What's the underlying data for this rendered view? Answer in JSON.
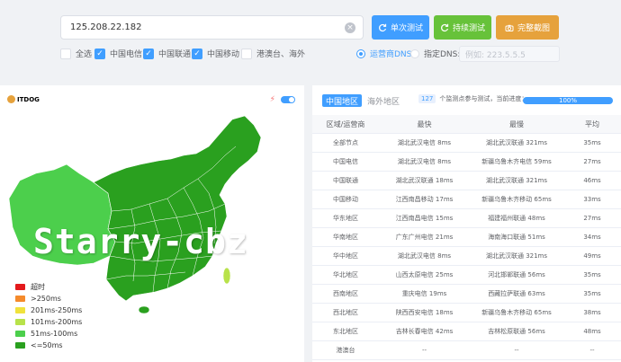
{
  "search": {
    "value": "125.208.22.182"
  },
  "buttons": {
    "single": "单次测试",
    "continuous": "持续测试",
    "screenshot": "完整截图"
  },
  "filters": [
    {
      "label": "全选",
      "checked": false
    },
    {
      "label": "中国电信",
      "checked": true
    },
    {
      "label": "中国联通",
      "checked": true
    },
    {
      "label": "中国移动",
      "checked": true
    },
    {
      "label": "港澳台、海外",
      "checked": false
    }
  ],
  "dns": {
    "carrier_label": "运营商DNS",
    "custom_label": "指定DNS:",
    "placeholder": "例如: 223.5.5.5"
  },
  "map": {
    "logo": "ITDOG",
    "watermark": "Starry-cbz",
    "legend": [
      {
        "label": "超时",
        "color": "#e31a1c"
      },
      {
        "label": ">250ms",
        "color": "#f58a2b"
      },
      {
        "label": "201ms-250ms",
        "color": "#f0e23c"
      },
      {
        "label": "101ms-200ms",
        "color": "#b8e24a"
      },
      {
        "label": "51ms-100ms",
        "color": "#4ccf4c"
      },
      {
        "label": "<=50ms",
        "color": "#2aa01f"
      }
    ]
  },
  "tabs": [
    {
      "label": "中国地区",
      "active": true
    },
    {
      "label": "海外地区",
      "active": false
    }
  ],
  "info": {
    "count": "127",
    "text": "个监测点参与测试，当前进度："
  },
  "progress": {
    "value": 100,
    "label": "100%"
  },
  "table": {
    "headers": [
      "区域/运营商",
      "最快",
      "最慢",
      "平均"
    ],
    "rows": [
      [
        "全部节点",
        "湖北武汉电信 8ms",
        "湖北武汉联通 321ms",
        "35ms"
      ],
      [
        "中国电信",
        "湖北武汉电信 8ms",
        "新疆乌鲁木齐电信 59ms",
        "27ms"
      ],
      [
        "中国联通",
        "湖北武汉联通 18ms",
        "湖北武汉联通 321ms",
        "46ms"
      ],
      [
        "中国移动",
        "江西南昌移动 17ms",
        "新疆乌鲁木齐移动 65ms",
        "33ms"
      ],
      [
        "华东地区",
        "江西南昌电信 15ms",
        "福建福州联通 48ms",
        "27ms"
      ],
      [
        "华南地区",
        "广东广州电信 21ms",
        "海南海口联通 51ms",
        "34ms"
      ],
      [
        "华中地区",
        "湖北武汉电信 8ms",
        "湖北武汉联通 321ms",
        "49ms"
      ],
      [
        "华北地区",
        "山西太原电信 25ms",
        "河北邯郸联通 56ms",
        "35ms"
      ],
      [
        "西南地区",
        "重庆电信 19ms",
        "西藏拉萨联通 63ms",
        "35ms"
      ],
      [
        "西北地区",
        "陕西西安电信 18ms",
        "新疆乌鲁木齐移动 65ms",
        "38ms"
      ],
      [
        "东北地区",
        "吉林长春电信 42ms",
        "吉林松原联通 56ms",
        "48ms"
      ],
      [
        "港澳台",
        "--",
        "--",
        "--"
      ]
    ]
  }
}
